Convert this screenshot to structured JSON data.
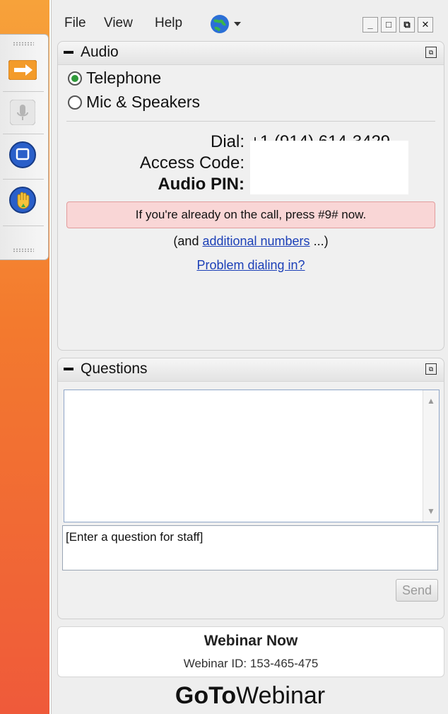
{
  "menu": {
    "file": "File",
    "view": "View",
    "help": "Help"
  },
  "window_controls": [
    "minimize",
    "maximize",
    "restore",
    "close"
  ],
  "audio_panel": {
    "title": "Audio",
    "options": [
      {
        "label": "Telephone",
        "selected": true
      },
      {
        "label": "Mic & Speakers",
        "selected": false
      }
    ],
    "dial_label": "Dial:",
    "dial_value": "+1 (914) 614-3429",
    "access_code_label": "Access Code:",
    "audio_pin_label": "Audio PIN:",
    "notice": "If you're already on the call, press #9# now.",
    "additional_prefix": "(and ",
    "additional_link": "additional numbers",
    "additional_suffix": " ...)",
    "problem_link": "Problem dialing in?"
  },
  "questions_panel": {
    "title": "Questions",
    "input_value": "[Enter a question for staff]",
    "send_label": "Send"
  },
  "webinar": {
    "name": "Webinar Now",
    "id_text": "Webinar ID: 153-465-475"
  },
  "brand": {
    "bold": "GoTo",
    "regular": "Webinar"
  },
  "colors": {
    "notice_bg": "#f9d6d6",
    "link": "#1b3fb7",
    "radio_selected": "#2f9a3a"
  }
}
